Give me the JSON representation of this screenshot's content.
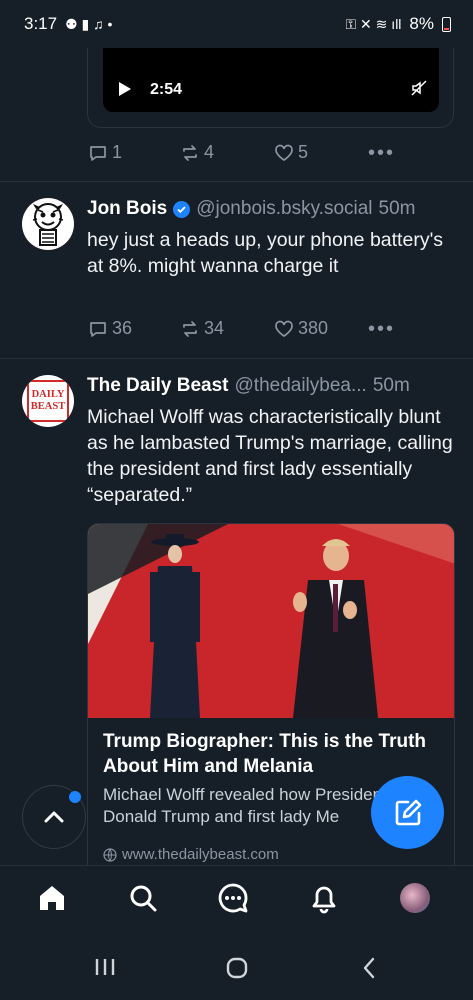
{
  "status_bar": {
    "time": "3:17",
    "battery_percent": "8%"
  },
  "prev_post": {
    "video_time": "2:54",
    "replies": "1",
    "reposts": "4",
    "likes": "5"
  },
  "post1": {
    "author": "Jon Bois",
    "handle": "@jonbois.bsky.social",
    "time": "50m",
    "text": "hey just a heads up, your phone battery's at 8%. might wanna charge it",
    "replies": "36",
    "reposts": "34",
    "likes": "380"
  },
  "post2": {
    "author": "The Daily Beast",
    "handle": "@thedailybea...",
    "time": "50m",
    "avatar_text": "DAILY BEAST",
    "text": "Michael Wolff was characteristically blunt as he lambasted Trump's marriage, calling the president and first lady essentially “separated.”",
    "embed": {
      "title": "Trump Biographer: This is the Truth About Him and Melania",
      "description": "Michael Wolff revealed how President Donald Trump and first lady Me",
      "domain": "www.thedailybeast.com"
    }
  },
  "bottom_nav": {
    "items": [
      "home",
      "search",
      "chat",
      "notifications",
      "profile"
    ]
  },
  "colors": {
    "background": "#161e27",
    "accent": "#1d83ff",
    "muted": "#8a96a3"
  }
}
